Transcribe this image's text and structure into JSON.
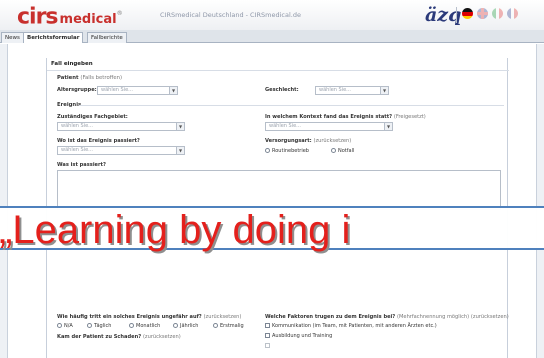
{
  "header": {
    "logo_main": "cirs",
    "logo_sub": "medical",
    "logo_mark": "®",
    "window_title": "CIRSmedical Deutschland - CIRSmedical.de",
    "org_logo": "äzq"
  },
  "tabs": [
    "News",
    "Berichtsformular",
    "Fallberichte"
  ],
  "form": {
    "heading": "Fall eingeben",
    "patient": {
      "label": "Patient",
      "hint": "(Falls betroffen)"
    },
    "age_label": "Altersgruppe:",
    "age_placeholder": "wählen Sie...",
    "gender_label": "Geschlecht:",
    "gender_placeholder": "wählen Sie...",
    "ereignis": "Ereignis",
    "specialty_label": "Zuständiges Fachgebiet:",
    "specialty_placeholder": "wählen Sie...",
    "context_label": "In welchem Kontext fand das Ereignis statt?",
    "context_hint": "(Freigesetzt)",
    "context_placeholder": "wählen Sie...",
    "where_label": "Wo ist das Ereignis passiert?",
    "where_placeholder": "wählen Sie...",
    "care_label": "Versorgungsart:",
    "care_hint": "(zurücksetzen)",
    "care_options": [
      "Routinebetrieb",
      "Notfall"
    ],
    "what_label": "Was ist passiert?",
    "frequency_label": "Wie häufig tritt ein solches Ereignis ungefähr auf?",
    "frequency_hint": "(zurücksetzen)",
    "frequency_options": [
      "N/A",
      "Täglich",
      "Monatlich",
      "Jährlich",
      "Erstmalig"
    ],
    "factors_label": "Welche Faktoren trugen zu dem Ereignis bei?",
    "factors_hint": "(Mehrfachnennung möglich)",
    "factors_reset": "(zurücksetzen)",
    "factors_options": [
      "Kommunikation (im Team, mit Patienten, mit anderen Ärzten etc.)",
      "Ausbildung und Training"
    ],
    "harm_label": "Kam der Patient zu Schaden?",
    "harm_hint": "(zurücksetzen)"
  },
  "banner": {
    "text": "„Learning by doing i"
  },
  "colors": {
    "logo_red": "#c8302d",
    "banner_red": "#e4201c",
    "azq_blue": "#2b3a7a",
    "banner_border": "#4f81bd"
  }
}
